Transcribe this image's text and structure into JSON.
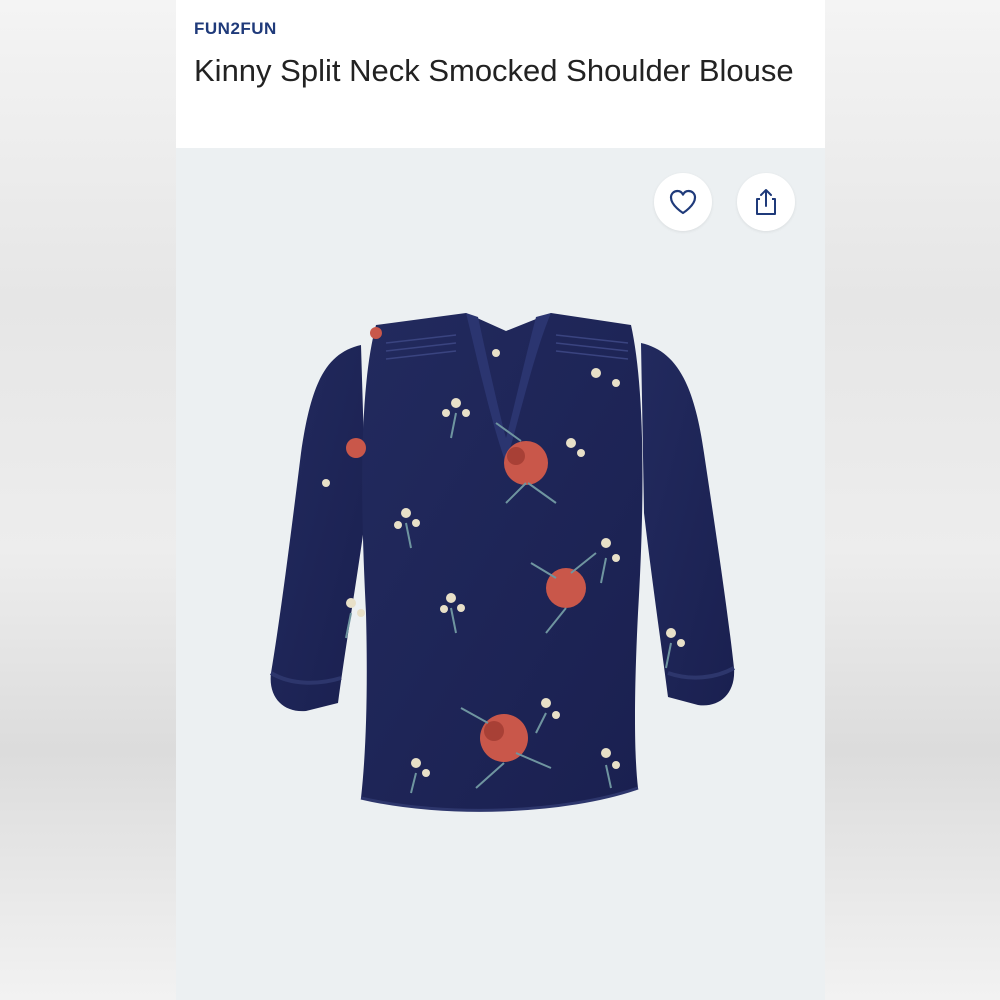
{
  "product": {
    "brand": "FUN2FUN",
    "title": "Kinny Split Neck Smocked Shoulder Blouse"
  },
  "actions": {
    "favorite_icon": "heart-icon",
    "share_icon": "share-icon"
  },
  "image": {
    "subject": "navy floral blouse",
    "colors": {
      "fabric": "#1e2454",
      "flower_red": "#c9574a",
      "flower_cream": "#e8e0c8",
      "leaf": "#6f95a0"
    }
  },
  "theme": {
    "brand_color": "#1f3a7a",
    "background": "#eceff1"
  }
}
